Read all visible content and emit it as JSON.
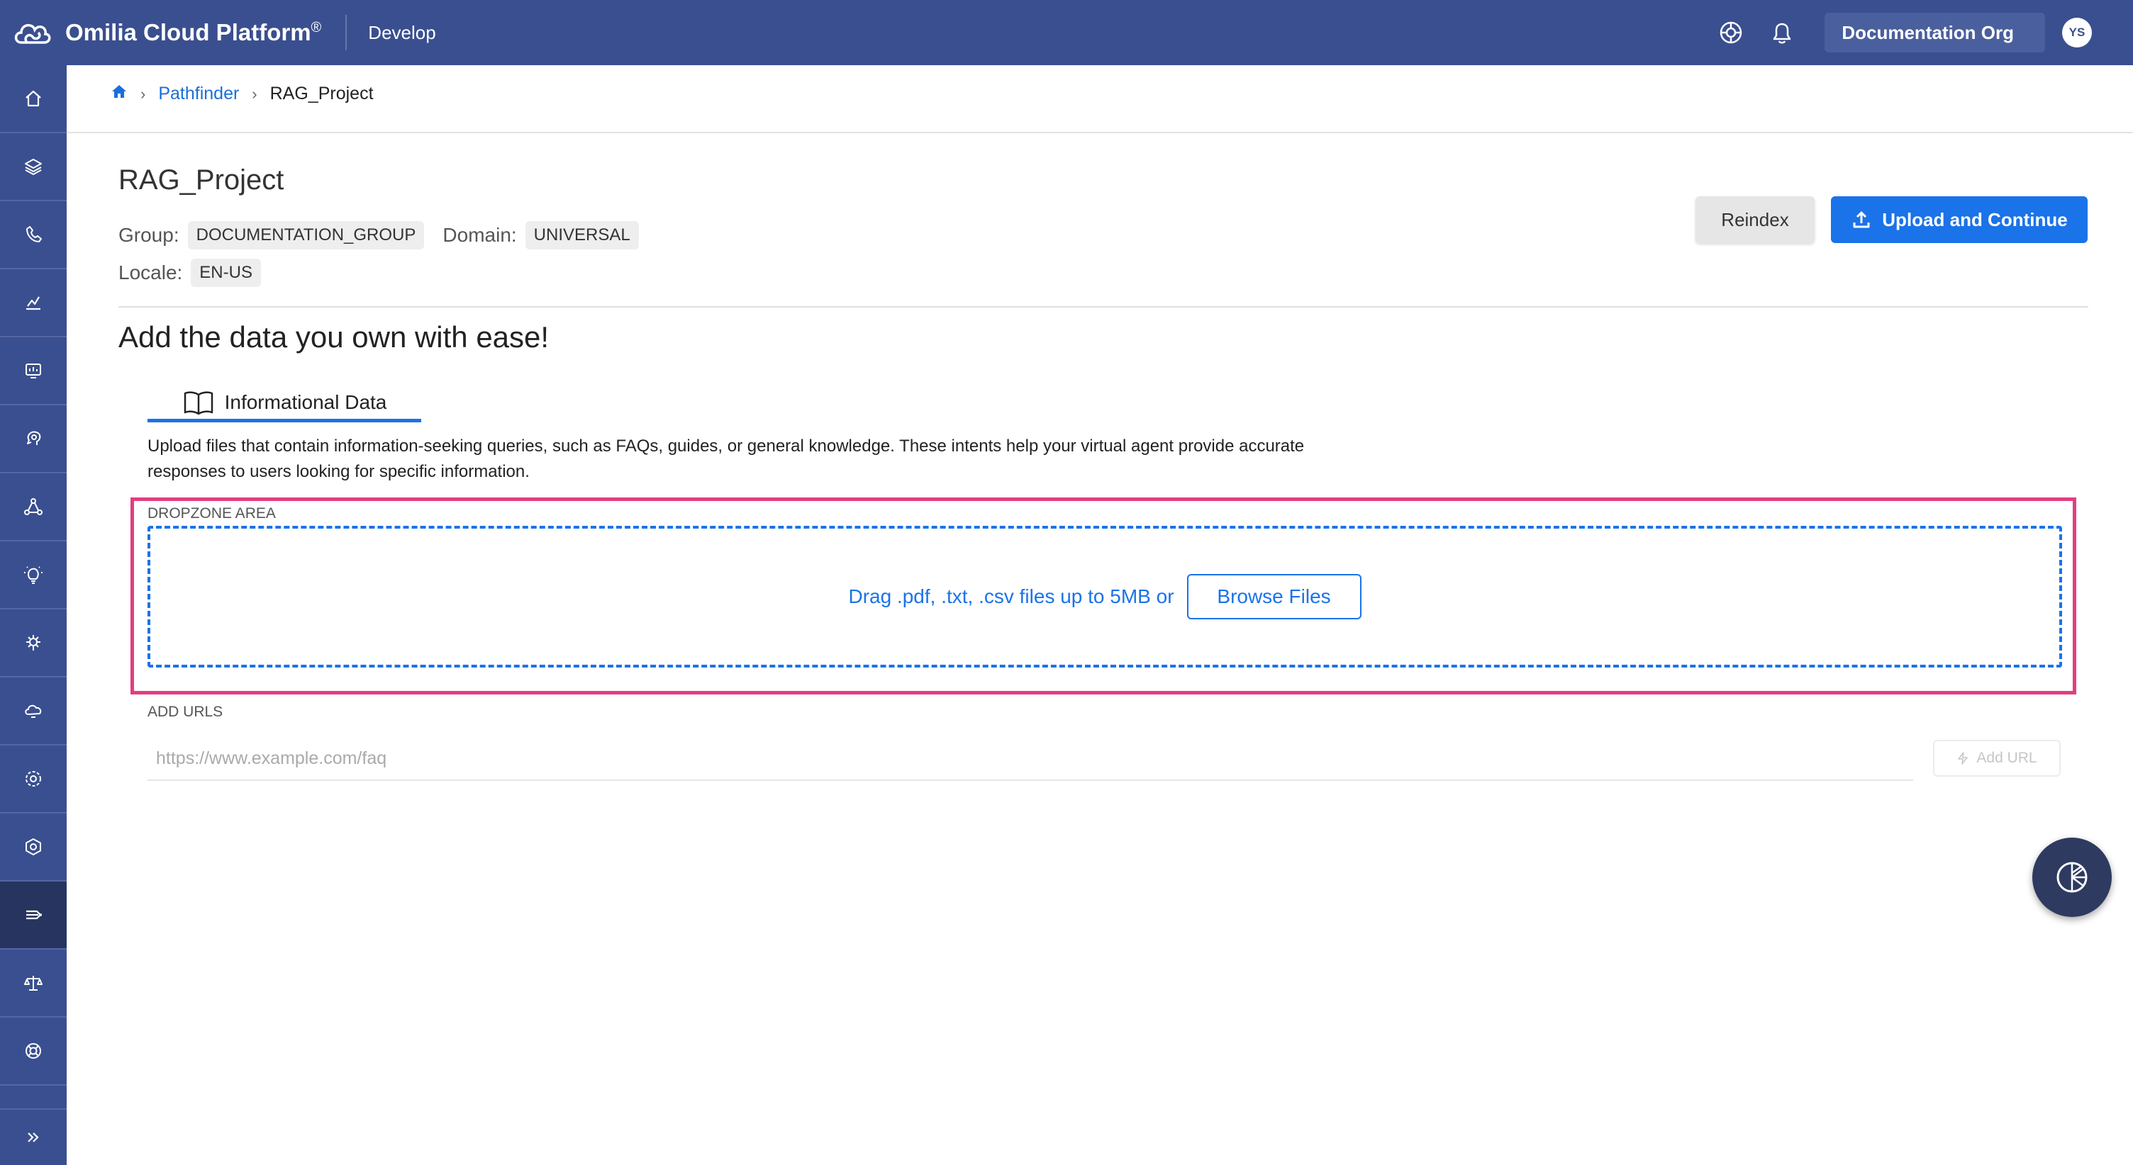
{
  "topbar": {
    "brand": "Omilia Cloud Platform",
    "brand_mark": "®",
    "section": "Develop",
    "org_button": "Documentation Org",
    "avatar_initials": "YS",
    "colors": {
      "bar": "#3a4f8f",
      "accent": "#1a73e8",
      "highlight": "#e33d81"
    }
  },
  "sidebar": {
    "items": [
      {
        "icon": "home-icon"
      },
      {
        "icon": "layers-icon"
      },
      {
        "icon": "phone-icon"
      },
      {
        "icon": "analytics-icon"
      },
      {
        "icon": "monitor-icon"
      },
      {
        "icon": "speech-icon"
      },
      {
        "icon": "network-icon"
      },
      {
        "icon": "lightbulb-icon"
      },
      {
        "icon": "brain-icon"
      },
      {
        "icon": "cloud-icon"
      },
      {
        "icon": "settings-icon"
      },
      {
        "icon": "hexagon-gear-icon"
      },
      {
        "icon": "pathfinder-icon",
        "active": true
      },
      {
        "icon": "scales-icon"
      },
      {
        "icon": "lifebuoy-icon"
      }
    ],
    "expand_icon": "double-chevron-right-icon"
  },
  "breadcrumb": {
    "link": "Pathfinder",
    "current": "RAG_Project"
  },
  "project": {
    "title": "RAG_Project",
    "group_label": "Group:",
    "group_value": "DOCUMENTATION_GROUP",
    "domain_label": "Domain:",
    "domain_value": "UNIVERSAL",
    "locale_label": "Locale:",
    "locale_value": "EN-US"
  },
  "actions": {
    "reindex": "Reindex",
    "upload": "Upload and Continue"
  },
  "headline": "Add the data you own with ease!",
  "tab": {
    "label": "Informational Data"
  },
  "description": "Upload files that contain information-seeking queries, such as FAQs, guides, or general knowledge. These intents help your virtual agent provide accurate responses to users looking for specific information.",
  "dropzone": {
    "label": "DROPZONE AREA",
    "text": "Drag .pdf, .txt, .csv files up to 5MB or",
    "browse": "Browse Files"
  },
  "urls": {
    "label": "ADD URLS",
    "placeholder": "https://www.example.com/faq",
    "add_button": "Add URL"
  }
}
